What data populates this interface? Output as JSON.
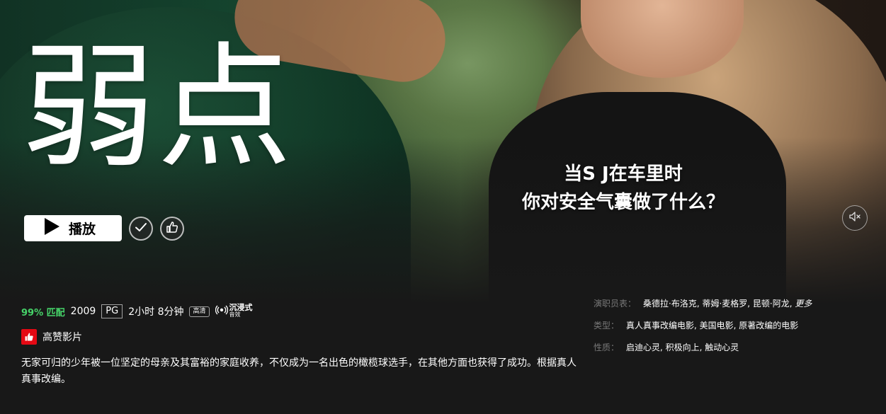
{
  "hero": {
    "title": "弱点",
    "subtitle_lines": [
      "当S J在车里时",
      "你对安全气囊做了什么？"
    ]
  },
  "controls": {
    "play_label": "播放",
    "play_icon": "play-icon",
    "add_icon": "check-icon",
    "like_icon": "thumbs-up-icon",
    "mute_icon": "speaker-muted-icon"
  },
  "meta": {
    "match": "99% 匹配",
    "year": "2009",
    "rating": "PG",
    "duration": "2小时 8分钟",
    "quality": "高清",
    "spatial_audio_line1": "沉浸式",
    "spatial_audio_line2": "音效"
  },
  "badge": {
    "label": "高赞影片",
    "icon": "thumbs-up-icon",
    "color": "#e50914"
  },
  "synopsis": "无家可归的少年被一位坚定的母亲及其富裕的家庭收养，不仅成为一名出色的橄榄球选手，在其他方面也获得了成功。根据真人真事改编。",
  "details": {
    "cast_label": "演职员表：",
    "cast_value": "桑德拉·布洛克, 蒂姆·麦格罗, 昆顿·阿龙, ",
    "cast_more": "更多",
    "genre_label": "类型：",
    "genre_value": "真人真事改编电影, 美国电影, 原著改编的电影",
    "traits_label": "性质：",
    "traits_value": "启迪心灵, 积极向上, 触动心灵"
  },
  "colors": {
    "match_green": "#46d369",
    "background": "#181818",
    "accent_red": "#e50914"
  }
}
